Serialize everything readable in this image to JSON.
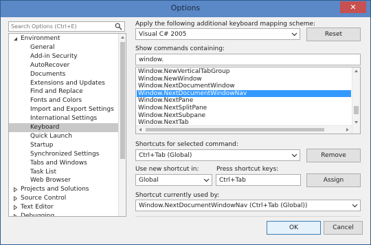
{
  "window": {
    "title": "Options",
    "close_glyph": "✕"
  },
  "search": {
    "placeholder": "Search Options (Ctrl+E)",
    "icon": "search-icon"
  },
  "tree": {
    "items": [
      {
        "label": "Environment",
        "level": 0,
        "expanded": true
      },
      {
        "label": "General",
        "level": 1
      },
      {
        "label": "Add-in Security",
        "level": 1
      },
      {
        "label": "AutoRecover",
        "level": 1
      },
      {
        "label": "Documents",
        "level": 1
      },
      {
        "label": "Extensions and Updates",
        "level": 1
      },
      {
        "label": "Find and Replace",
        "level": 1
      },
      {
        "label": "Fonts and Colors",
        "level": 1
      },
      {
        "label": "Import and Export Settings",
        "level": 1
      },
      {
        "label": "International Settings",
        "level": 1
      },
      {
        "label": "Keyboard",
        "level": 1,
        "selected": true
      },
      {
        "label": "Quick Launch",
        "level": 1
      },
      {
        "label": "Startup",
        "level": 1
      },
      {
        "label": "Synchronized Settings",
        "level": 1
      },
      {
        "label": "Tabs and Windows",
        "level": 1
      },
      {
        "label": "Task List",
        "level": 1
      },
      {
        "label": "Web Browser",
        "level": 1
      },
      {
        "label": "Projects and Solutions",
        "level": 0,
        "expanded": false
      },
      {
        "label": "Source Control",
        "level": 0,
        "expanded": false
      },
      {
        "label": "Text Editor",
        "level": 0,
        "expanded": false
      },
      {
        "label": "Debugging",
        "level": 0,
        "expanded": false
      }
    ]
  },
  "mapping": {
    "label": "Apply the following additional keyboard mapping scheme:",
    "value": "Visual C# 2005",
    "reset_label": "Reset"
  },
  "commands": {
    "label": "Show commands containing:",
    "filter": "window.",
    "items": [
      "Window.NewVerticalTabGroup",
      "Window.NewWindow",
      "Window.NextDocumentWindow",
      "Window.NextDocumentWindowNav",
      "Window.NextPane",
      "Window.NextSplitPane",
      "Window.NextSubpane",
      "Window.NextTab"
    ],
    "selected_index": 3
  },
  "shortcuts": {
    "label": "Shortcuts for selected command:",
    "value": "Ctrl+Tab (Global)",
    "remove_label": "Remove"
  },
  "new_shortcut": {
    "use_in_label": "Use new shortcut in:",
    "use_in_value": "Global",
    "press_label": "Press shortcut keys:",
    "press_value": "Ctrl+Tab",
    "assign_label": "Assign"
  },
  "used_by": {
    "label": "Shortcut currently used by:",
    "value": "Window.NextDocumentWindowNav (Ctrl+Tab (Global))"
  },
  "footer": {
    "ok_label": "OK",
    "cancel_label": "Cancel"
  },
  "colors": {
    "titlebar": "#5b88c6",
    "close": "#c75050",
    "selection": "#3399ff",
    "tree_selection": "#c8c8c8"
  }
}
